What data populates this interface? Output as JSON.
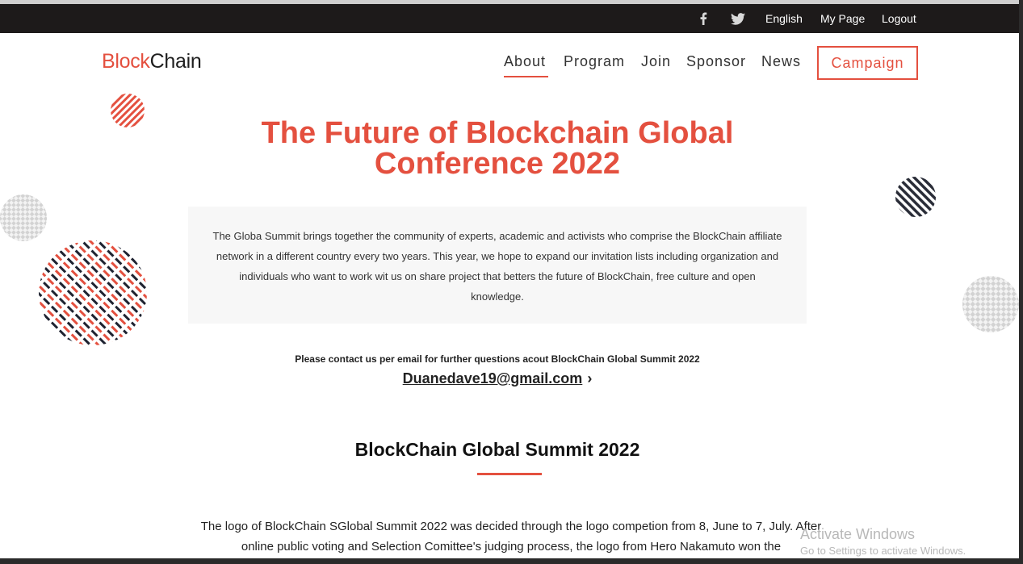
{
  "topbar": {
    "social": [
      "facebook-icon",
      "twitter-icon"
    ],
    "links": {
      "english": "English",
      "mypage": "My Page",
      "logout": "Logout"
    }
  },
  "brand": {
    "part1": "Block",
    "part2": "Chain"
  },
  "nav": {
    "about": "About",
    "program": "Program",
    "join": "Join",
    "sponsor": "Sponsor",
    "news": "News",
    "campaign": "Campaign",
    "active": "About"
  },
  "hero": {
    "title": "The Future of Blockchain Global Conference 2022",
    "intro": "The Globa Summit brings together the community of experts, academic and activists who comprise the BlockChain affiliate network in a different country every two years. This year, we hope to expand our invitation lists including organization and individuals who want to work wit us on share project that betters the future of BlockChain, free culture and open knowledge."
  },
  "contact": {
    "note": "Please contact us per email for further questions acout BlockChain Global Summit 2022",
    "email": "Duanedave19@gmail.com",
    "chevron": "›"
  },
  "section": {
    "title": "BlockChain Global Summit 2022",
    "body": "The logo of BlockChain SGlobal Summit 2022 was decided through the logo competion from 8, June to 7, July. After online public voting and Selection Comittee's judging process, the logo from Hero Nakamuto won the"
  },
  "watermark": {
    "line1": "Activate Windows",
    "line2": "Go to Settings to activate Windows."
  },
  "colors": {
    "accent": "#e4503f",
    "dark": "#1d1a1a",
    "box": "#f7f7f7"
  }
}
